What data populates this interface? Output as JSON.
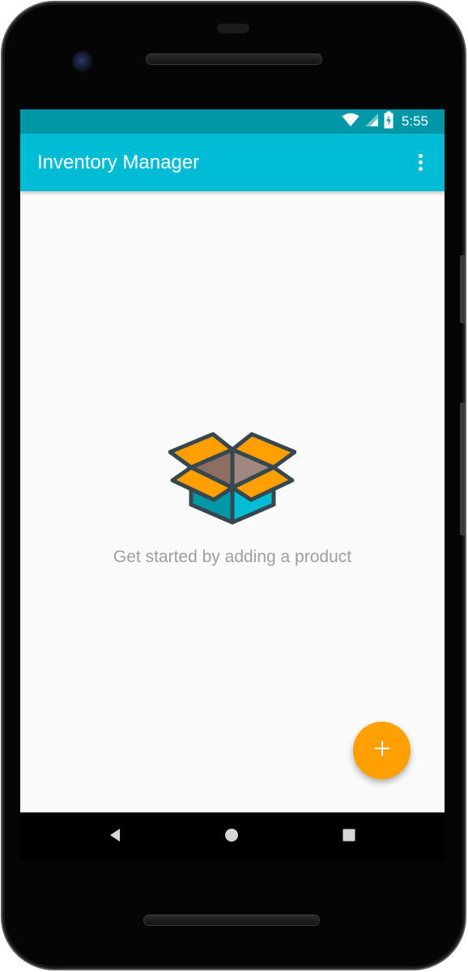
{
  "status_bar": {
    "time": "5:55",
    "wifi_icon": "wifi-icon",
    "signal_icon": "cell-signal-icon",
    "battery_icon": "battery-charging-icon",
    "background_color": "#0097a7"
  },
  "app_bar": {
    "title": "Inventory Manager",
    "overflow_icon": "more-vert-icon",
    "background_color": "#00bcd4"
  },
  "empty_state": {
    "illustration": "open-box-icon",
    "message": "Get started by adding a product"
  },
  "fab": {
    "icon": "add-icon",
    "color": "#ffa000"
  },
  "navigation_bar": {
    "back_icon": "back-triangle-icon",
    "home_icon": "home-circle-icon",
    "recents_icon": "recents-square-icon"
  }
}
